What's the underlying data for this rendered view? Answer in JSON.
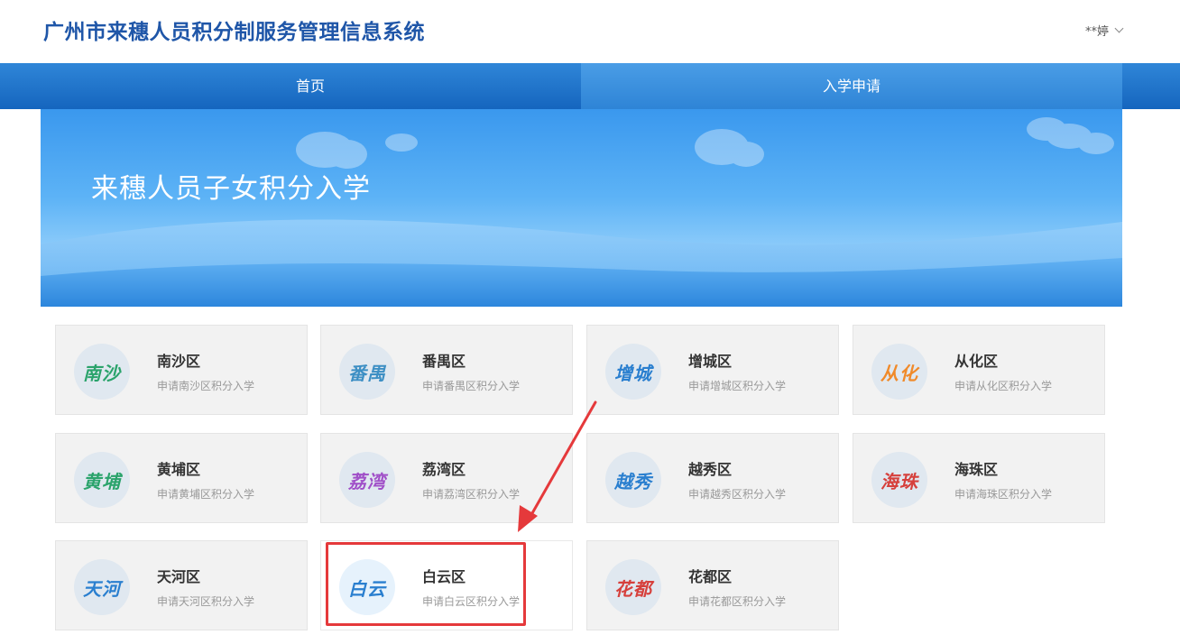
{
  "header": {
    "title": "广州市来穗人员积分制服务管理信息系统",
    "user": "**婷"
  },
  "nav": {
    "tabs": [
      "首页",
      "入学申请"
    ]
  },
  "banner": {
    "title": "来穗人员子女积分入学"
  },
  "colors": {
    "primary": "#1f56a8",
    "nav": "#1565be",
    "highlight": "#e5393b"
  },
  "districts": [
    {
      "badge": "南沙",
      "name": "南沙区",
      "desc": "申请南沙区积分入学",
      "color": "#2aa36b"
    },
    {
      "badge": "番禺",
      "name": "番禺区",
      "desc": "申请番禺区积分入学",
      "color": "#3d8fc4"
    },
    {
      "badge": "增城",
      "name": "增城区",
      "desc": "申请增城区积分入学",
      "color": "#2a7fcf"
    },
    {
      "badge": "从化",
      "name": "从化区",
      "desc": "申请从化区积分入学",
      "color": "#f08a2a"
    },
    {
      "badge": "黄埔",
      "name": "黄埔区",
      "desc": "申请黄埔区积分入学",
      "color": "#2aa36b"
    },
    {
      "badge": "荔湾",
      "name": "荔湾区",
      "desc": "申请荔湾区积分入学",
      "color": "#a04fc8"
    },
    {
      "badge": "越秀",
      "name": "越秀区",
      "desc": "申请越秀区积分入学",
      "color": "#2a7fcf"
    },
    {
      "badge": "海珠",
      "name": "海珠区",
      "desc": "申请海珠区积分入学",
      "color": "#d6403c"
    },
    {
      "badge": "天河",
      "name": "天河区",
      "desc": "申请天河区积分入学",
      "color": "#2a7fcf"
    },
    {
      "badge": "白云",
      "name": "白云区",
      "desc": "申请白云区积分入学",
      "color": "#2a7fcf"
    },
    {
      "badge": "花都",
      "name": "花都区",
      "desc": "申请花都区积分入学",
      "color": "#d6403c"
    }
  ]
}
